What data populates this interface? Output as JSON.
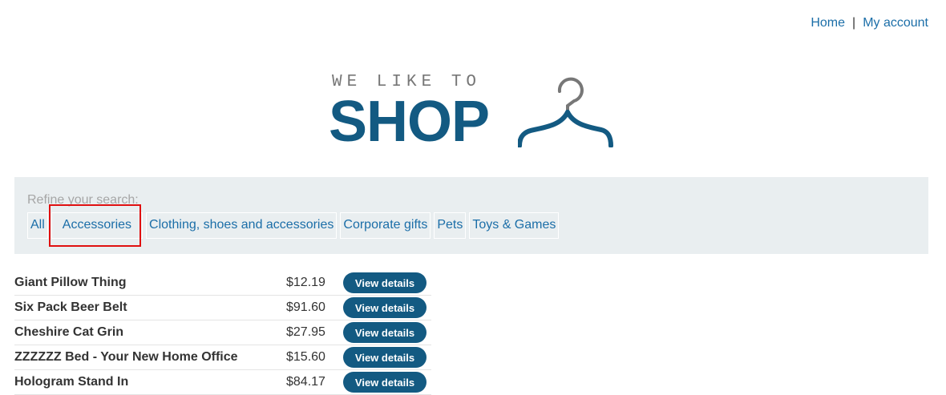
{
  "nav": {
    "home": "Home",
    "separator": "|",
    "account": "My account"
  },
  "logo": {
    "small_text": "WE LIKE TO",
    "big_text": "SHOP",
    "icon": "hanger-icon"
  },
  "filter": {
    "label": "Refine your search:",
    "links": [
      "All",
      "Accessories",
      "Clothing, shoes and accessories",
      "Corporate gifts",
      "Pets",
      "Toys & Games"
    ],
    "highlighted": "Accessories"
  },
  "products": [
    {
      "name": "Giant Pillow Thing",
      "price": "$12.19",
      "button": "View details"
    },
    {
      "name": "Six Pack Beer Belt",
      "price": "$91.60",
      "button": "View details"
    },
    {
      "name": "Cheshire Cat Grin",
      "price": "$27.95",
      "button": "View details"
    },
    {
      "name": "ZZZZZZ Bed - Your New Home Office",
      "price": "$15.60",
      "button": "View details"
    },
    {
      "name": "Hologram Stand In",
      "price": "$84.17",
      "button": "View details"
    }
  ],
  "colors": {
    "brand": "#135a82",
    "link": "#1b6ea8",
    "highlight": "#e01010",
    "filter_bg": "#e9eef0"
  }
}
